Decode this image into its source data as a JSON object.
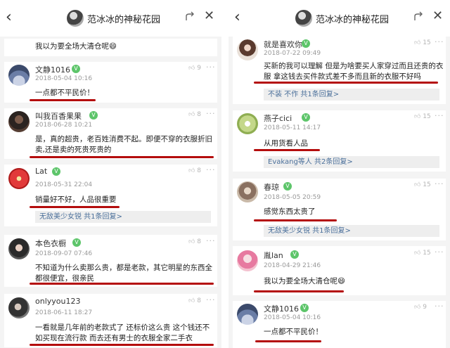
{
  "header": {
    "back_icon": "chevron-left-icon",
    "title": "范冰冰的神秘花园",
    "share_icon": "share-icon",
    "close_icon": "close-icon"
  },
  "badge_text": "V",
  "like_icon": "thumb-up-icon",
  "more_icon": "more-dots-icon",
  "underline_color": "#b40d0d",
  "accent_green": "#5dc56a",
  "left_panel": {
    "top_fragment": "我以为要全场大清仓呢😄",
    "comments": [
      {
        "user": "文静1016",
        "time": "2018-05-04 10:16",
        "likes": "9",
        "text": "一点都不平民价！"
      },
      {
        "user": "叫我百香果果",
        "time": "2018-06-28 10:21",
        "likes": "8",
        "text": "是，真的超贵，老百姓消费不起。即便不穿的衣服折旧卖,还是卖的死贵死贵的"
      },
      {
        "user": "Lat",
        "time": "2018-05-31 22:04",
        "likes": "8",
        "text": "销量好不好，人品很重要",
        "reply": "无敌美少女锐 共1条回复>"
      },
      {
        "user": "本色衣橱",
        "time": "2018-09-07 07:46",
        "likes": "8",
        "text": "不知道为什么卖那么贵，都是老款，其它明星的东西全都很便宜，很亲民"
      },
      {
        "user": "onlyyou123",
        "time": "2018-06-11 18:27",
        "likes": "8",
        "text": "一看就是几年前的老款式了 还标价这么贵 这个钱还不如买现在流行款 而去还有男士的衣服全家二手衣"
      }
    ]
  },
  "right_panel": {
    "comments": [
      {
        "user": "就是喜欢你",
        "time": "2018-07-22 09:49",
        "likes": "15",
        "text": "买新的我可以理解 但是为啥要买人家穿过而且还贵的衣服 拿这钱去买件款式差不多而且新的衣服不好吗",
        "reply": "不装 不作 共1条回复>"
      },
      {
        "user": "燕子cici",
        "time": "2018-05-11 14:17",
        "likes": "15",
        "text": "从用货看人品",
        "reply": "Evakang等人 共2条回复>"
      },
      {
        "user": "春琼",
        "time": "2018-05-05 20:59",
        "likes": "15",
        "text": "感觉东西太贵了",
        "reply": "无敌美少女锐 共1条回复>"
      },
      {
        "user": "胤lan",
        "time": "2018-04-29 21:46",
        "likes": "15",
        "text": "我以为要全场大清仓呢😄"
      },
      {
        "user": "文静1016",
        "time": "2018-05-04 10:16",
        "likes": "9",
        "text": "一点都不平民价！"
      }
    ]
  }
}
